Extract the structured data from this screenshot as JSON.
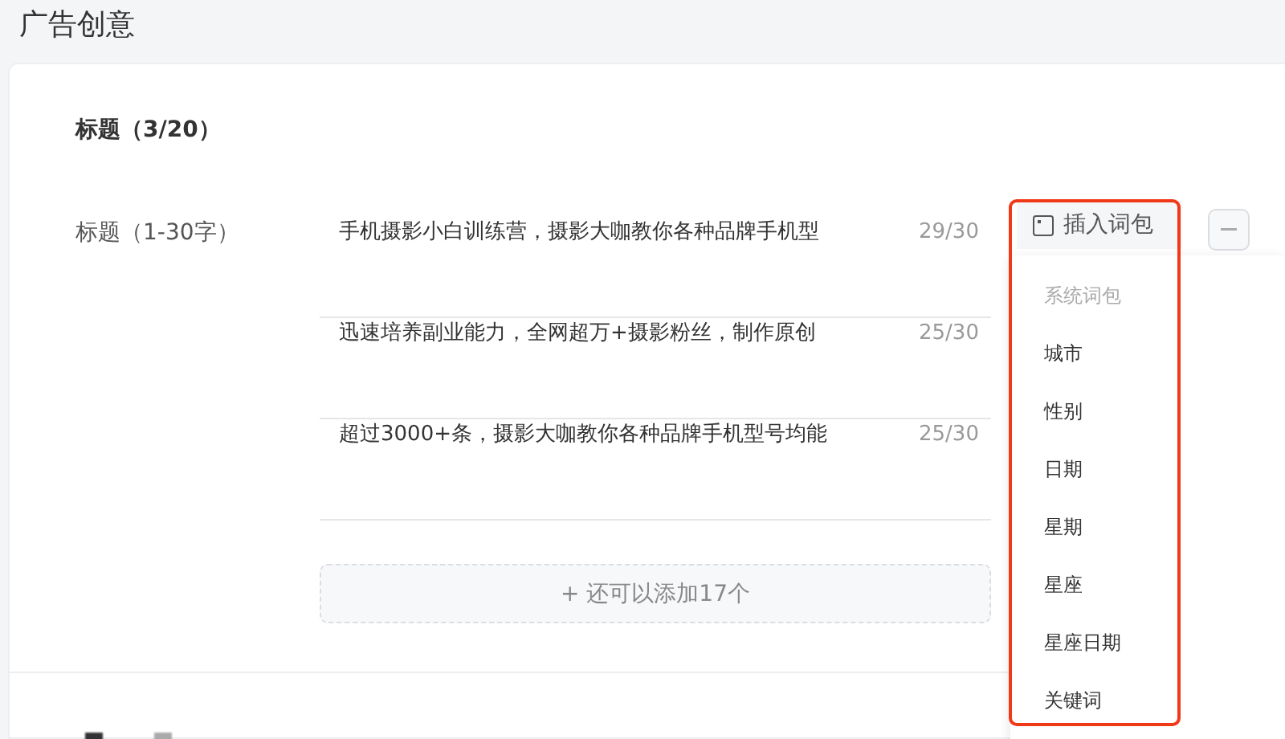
{
  "page_title": "广告创意",
  "section": {
    "heading": "标题（3/20）",
    "field_label": "标题（1-30字）",
    "titles": [
      {
        "value": "手机摄影小白训练营，摄影大咖教你各种品牌手机型",
        "count": "29/30"
      },
      {
        "value": "迅速培养副业能力，全网超万+摄影粉丝，制作原创",
        "count": "25/30"
      },
      {
        "value": "超过3000+条，摄影大咖教你各种品牌手机型号均能",
        "count": "25/30"
      }
    ],
    "insert_button": "插入词包",
    "add_button": "+ 还可以添加17个"
  },
  "dropdown": {
    "group": "系统词包",
    "items": [
      "城市",
      "性别",
      "日期",
      "星期",
      "星座",
      "星座日期",
      "关键词"
    ]
  }
}
